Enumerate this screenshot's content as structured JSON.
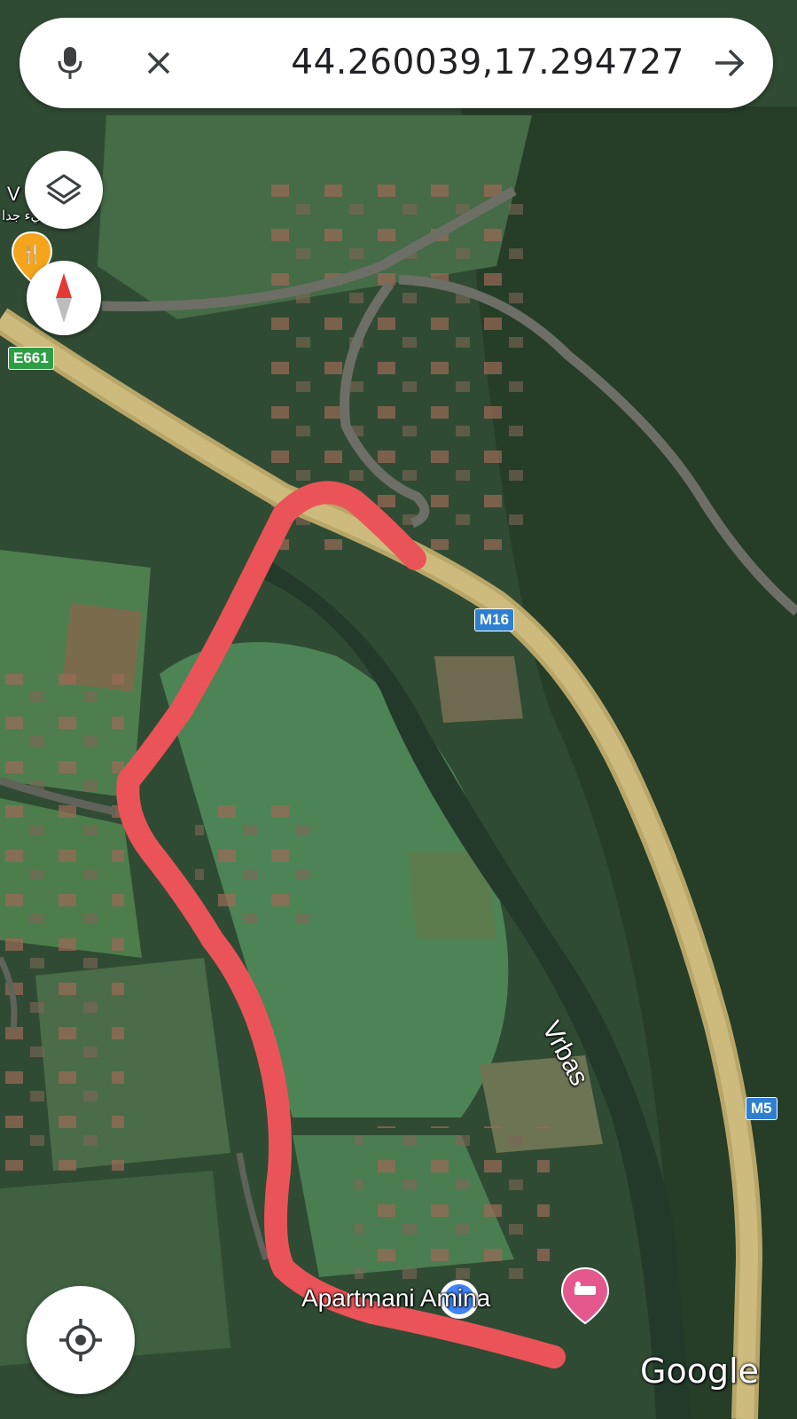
{
  "search": {
    "query": "44.260039,17.294727",
    "mic_icon": "microphone-icon",
    "clear_icon": "close-icon",
    "submit_icon": "arrow-right-icon"
  },
  "controls": {
    "layers_icon": "layers-icon",
    "compass_icon": "compass-icon",
    "locate_icon": "my-location-icon"
  },
  "map": {
    "type": "satellite",
    "road_badges": {
      "e661": "E661",
      "m16": "M16",
      "m5": "M5"
    },
    "river_label": "Vrbas",
    "poi_partial_label": "V",
    "poi_review_text": "ليس سيء جدا",
    "place_label": "Apartmani Amina",
    "attribution": "Google",
    "route_color": "#ea5458",
    "main_road_color": "#c9b774",
    "poi_color": "#f4a51c",
    "hotel_pin_color": "#e5588e",
    "location_dot_color": "#4285f4"
  }
}
